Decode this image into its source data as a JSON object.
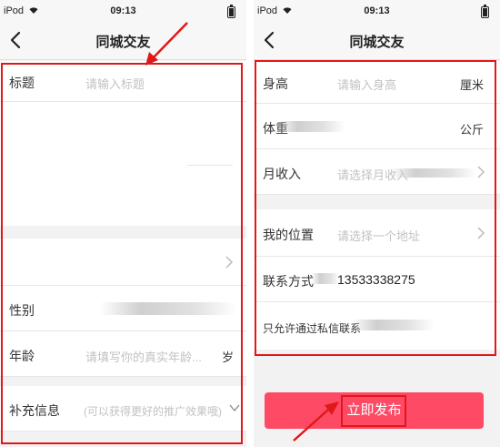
{
  "status": {
    "device": "iPod",
    "time": "09:13"
  },
  "left": {
    "nav_title": "同城交友",
    "title_label": "标题",
    "title_placeholder": "请输入标题",
    "gender_label": "性别",
    "age_label": "年龄",
    "age_placeholder": "请填写你的真实年龄...",
    "age_unit": "岁",
    "extra_label": "补充信息",
    "extra_placeholder": "(可以获得更好的推广效果哦)"
  },
  "right": {
    "nav_title": "同城交友",
    "height_label": "身高",
    "height_placeholder": "请输入身高",
    "height_unit": "厘米",
    "weight_label": "体重",
    "weight_unit": "公斤",
    "income_label": "月收入",
    "income_placeholder": "请选择月收入",
    "location_label": "我的位置",
    "location_placeholder": "请选择一个地址",
    "contact_label": "联系方式",
    "contact_value": "13533338275",
    "privacy_text": "只允许通过私信联系",
    "publish_label": "立即发布"
  },
  "colors": {
    "accent": "#ff4a66",
    "annotation": "#e01818",
    "placeholder": "#c2c2c2"
  },
  "icons": [
    "wifi-icon",
    "battery-icon",
    "back-chevron-icon",
    "chevron-right-icon",
    "chevron-down-icon",
    "annotation-arrow-icon"
  ]
}
